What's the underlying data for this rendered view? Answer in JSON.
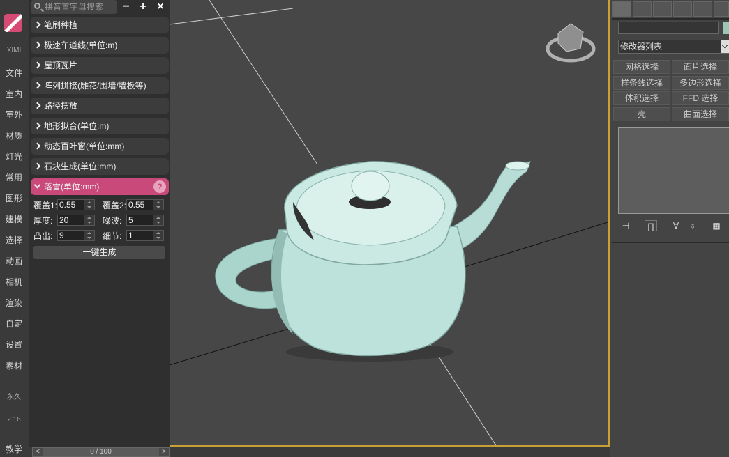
{
  "sidebar": {
    "brand": "XIMI",
    "items": [
      "文件",
      "室内",
      "室外",
      "材质",
      "灯光",
      "常用",
      "图形",
      "建模",
      "选择",
      "动画",
      "相机",
      "渲染",
      "自定",
      "设置",
      "素材"
    ],
    "license": "永久",
    "version": "2.16",
    "tutorial": "教学"
  },
  "plugin": {
    "search_placeholder": "拼音首字母搜索",
    "buttons": {
      "minimize": "−",
      "add": "+",
      "close": "×"
    },
    "categories": [
      "笔刷种植",
      "极速车道线(单位:m)",
      "屋顶瓦片",
      "阵列拼接(雕花/围墙/墙板等)",
      "路径摆放",
      "地形拟合(单位:m)",
      "动态百叶窗(单位:mm)",
      "石块生成(单位:mm)"
    ],
    "active_category": "落雪(单位:mm)",
    "help_icon": "?",
    "fields": {
      "cover1": {
        "label": "覆盖1:",
        "value": "0.55"
      },
      "cover2": {
        "label": "覆盖2:",
        "value": "0.55"
      },
      "thickness": {
        "label": "厚度:",
        "value": "20"
      },
      "noise": {
        "label": "噪波:",
        "value": "5"
      },
      "bulge": {
        "label": "凸出:",
        "value": "9"
      },
      "detail": {
        "label": "细节:",
        "value": "1"
      }
    },
    "generate_label": "一键生成"
  },
  "timeline": {
    "prev": "<",
    "frame": "0 / 100",
    "next": ">"
  },
  "command_panel": {
    "modifier_list": "修改器列表",
    "buttons": [
      "网格选择",
      "面片选择",
      "样条线选择",
      "多边形选择",
      "体积选择",
      "FFD 选择",
      "壳",
      "曲面选择"
    ]
  },
  "colors": {
    "accent": "#c8497a",
    "teapot": "#b9e0d8",
    "viewport_border": "#c8a034"
  }
}
